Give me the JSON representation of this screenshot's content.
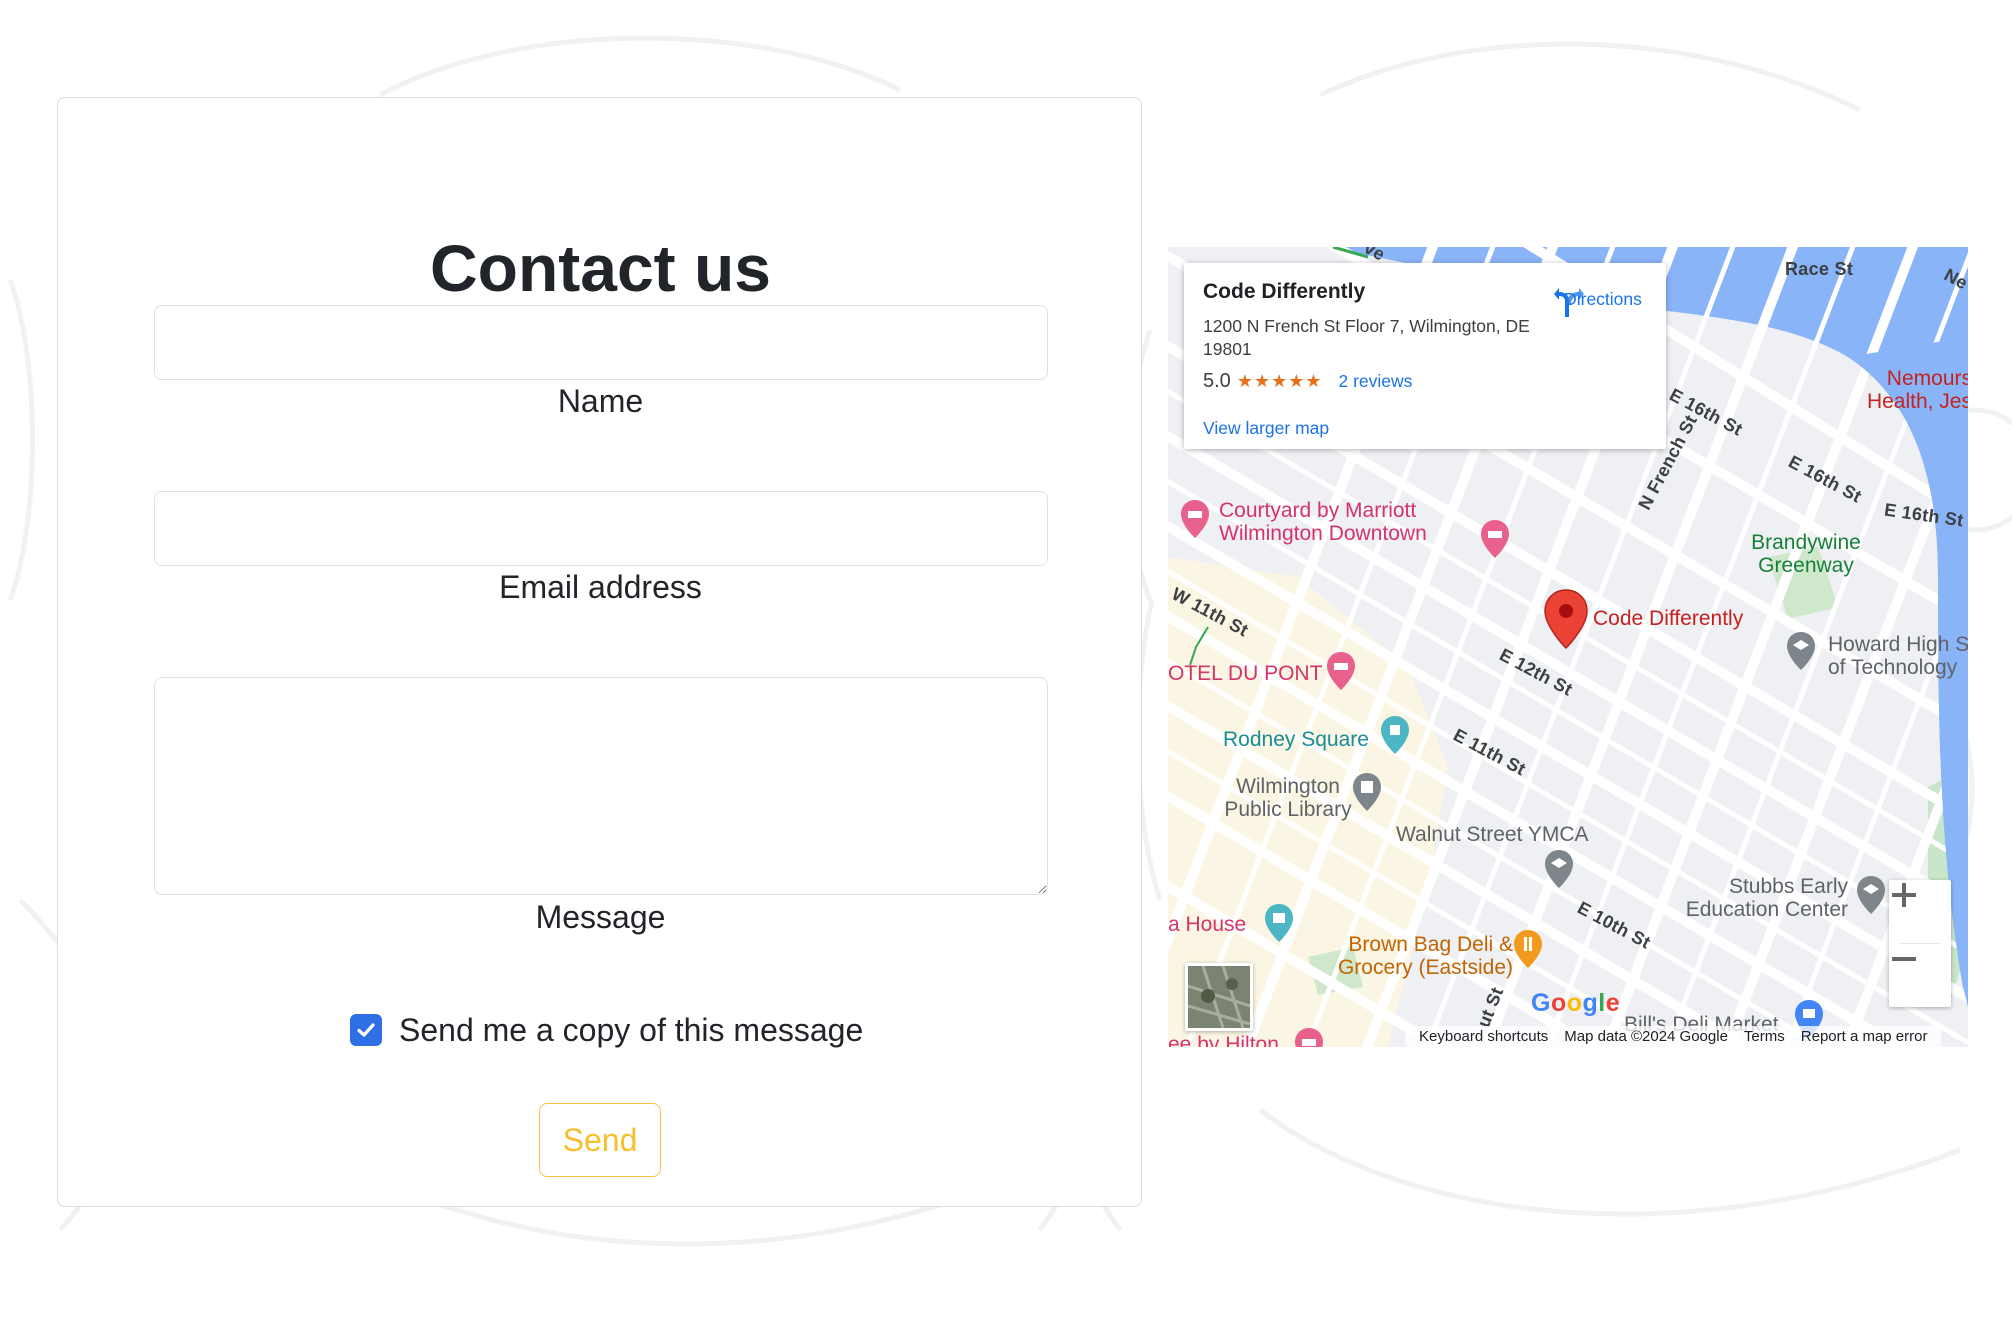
{
  "form": {
    "title": "Contact us",
    "name_label": "Name",
    "email_label": "Email address",
    "message_label": "Message",
    "copy_label": "Send me a copy of this message",
    "copy_checked": true,
    "send_label": "Send"
  },
  "map": {
    "place_name": "Code Differently",
    "address": "1200 N French St Floor 7, Wilmington, DE 19801",
    "rating": "5.0",
    "stars": "★★★★★",
    "reviews_link": "2 reviews",
    "larger_map_link": "View larger map",
    "directions_label": "Directions",
    "pin_label": "Code Differently",
    "places": {
      "courtyard": "Courtyard by Marriott Wilmington Downtown",
      "hotel_du_pont": "OTEL DU PONT",
      "rodney_square": "Rodney Square",
      "library": "Wilmington Public Library",
      "ymca": "Walnut Street YMCA",
      "brandywine": "Brandywine Greenway",
      "nemours": "Nemours Health, Jes",
      "howard": "Howard High S of Technology",
      "stubbs": "Stubbs Early Education Center",
      "brown_bag": "Brown Bag Deli & Grocery (Eastside)",
      "a_house": "a House",
      "bills_deli": "Bill's Deli Market",
      "hilton": "ee by Hilton"
    },
    "streets": {
      "race": "Race St",
      "e16_a": "E 16th St",
      "e16_b": "E 16th St",
      "e16_c": "E 16th St",
      "n_french": "N French St",
      "w11": "W 11th St",
      "e12": "E 12th St",
      "e11": "E 11th St",
      "e10": "E 10th St",
      "ut_st": "ut St",
      "ne": "Ne",
      "ave": "ve"
    },
    "google_logo": "Google",
    "keyboard_shortcuts": "Keyboard shortcuts",
    "map_data": "Map data ©2024 Google",
    "terms": "Terms",
    "report": "Report a map error",
    "colors": {
      "river": "#8ab4f8",
      "park": "#c8e6c9",
      "pin": "#ea4335",
      "link": "#1a73e8"
    }
  }
}
